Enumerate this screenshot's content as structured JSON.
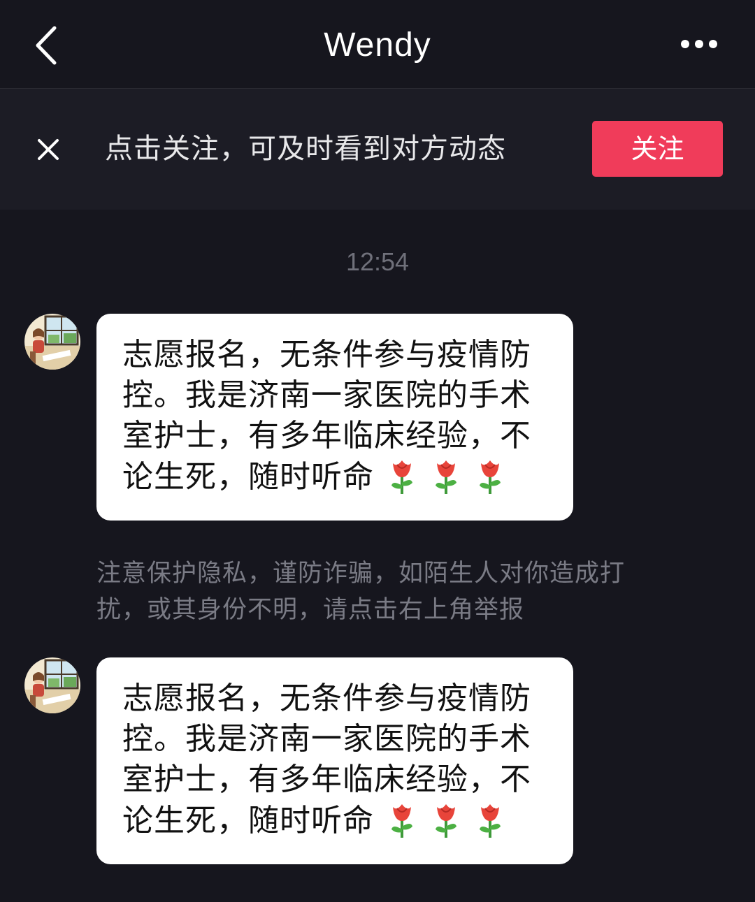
{
  "header": {
    "title": "Wendy"
  },
  "follow_banner": {
    "text": "点击关注，可及时看到对方动态",
    "button_label": "关注",
    "button_color": "#f03c5a"
  },
  "chat": {
    "timestamp": "12:54",
    "messages": [
      {
        "text": "志愿报名，无条件参与疫情防控。我是济南一家医院的手术室护士，有多年临床经验，不论生死，随时听命",
        "emoji": [
          "rose-icon",
          "rose-icon",
          "rose-icon"
        ]
      },
      {
        "text": "志愿报名，无条件参与疫情防控。我是济南一家医院的手术室护士，有多年临床经验，不论生死，随时听命",
        "emoji": [
          "rose-icon",
          "rose-icon",
          "rose-icon"
        ]
      }
    ],
    "notice": "注意保护隐私，谨防诈骗，如陌生人对你造成打扰，或其身份不明，请点击右上角举报"
  },
  "icons": {
    "back": "chevron-left-icon",
    "more": "more-horizontal-icon",
    "close": "close-icon"
  },
  "colors": {
    "background": "#16161e",
    "banner_background": "#1c1c25",
    "bubble": "#ffffff"
  }
}
